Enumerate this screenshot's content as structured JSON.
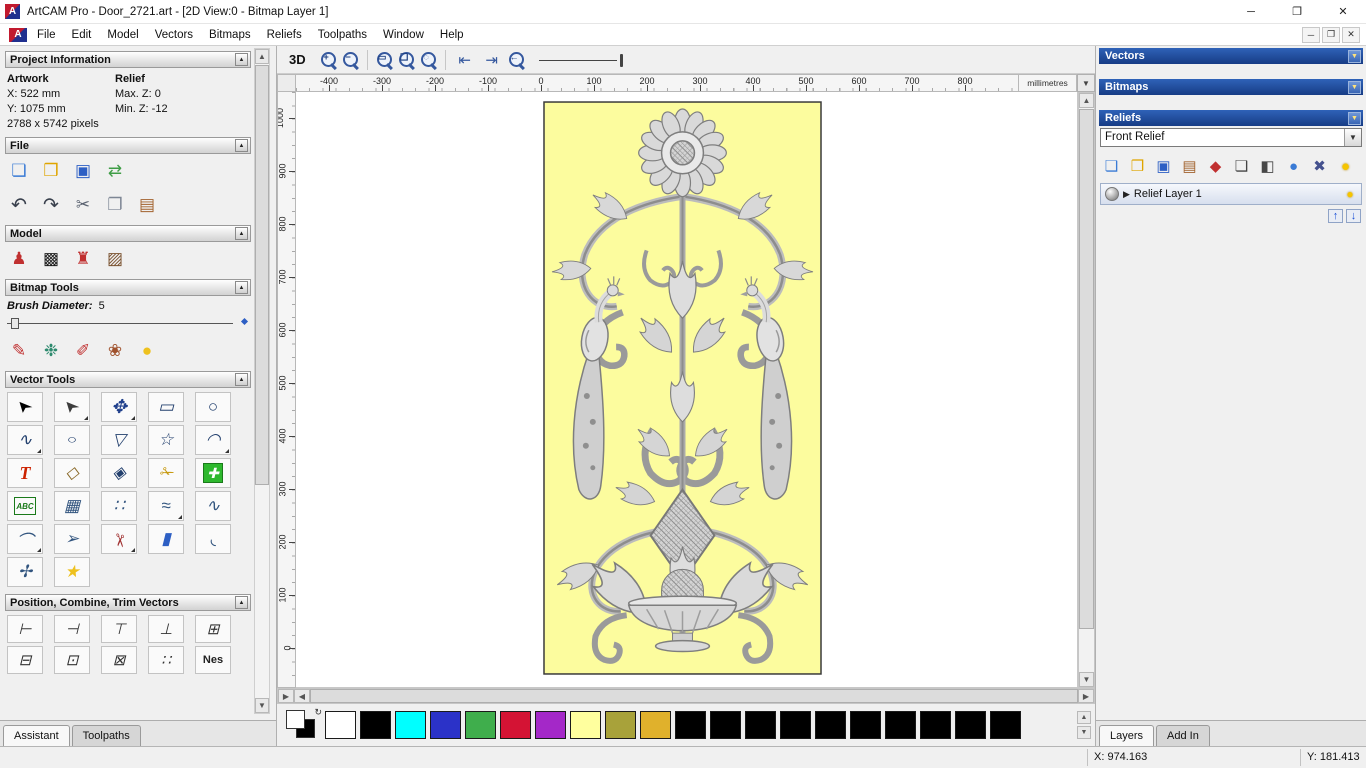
{
  "window": {
    "title": "ArtCAM Pro - Door_2721.art - [2D View:0 - Bitmap Layer 1]",
    "app_initial": "A"
  },
  "menu": {
    "items": [
      "File",
      "Edit",
      "Model",
      "Vectors",
      "Bitmaps",
      "Reliefs",
      "Toolpaths",
      "Window",
      "Help"
    ]
  },
  "assistant": {
    "tabs": {
      "assistant": "Assistant",
      "toolpaths": "Toolpaths"
    },
    "project_info": {
      "title": "Project Information",
      "artwork_label": "Artwork",
      "relief_label": "Relief",
      "x": "X: 522 mm",
      "y": "Y: 1075 mm",
      "pixels": "2788 x 5742 pixels",
      "max_z": "Max. Z: 0",
      "min_z": "Min. Z: -12"
    },
    "file_title": "File",
    "model_title": "Model",
    "bitmap_tools": {
      "title": "Bitmap Tools",
      "brush_label": "Brush Diameter:",
      "brush_value": "5"
    },
    "vector_tools_title": "Vector Tools",
    "position_title": "Position, Combine, Trim Vectors",
    "nesting_label": "Nes"
  },
  "view": {
    "toolbar": {
      "view_3d": "3D"
    },
    "ruler": {
      "horizontal": [
        "-400",
        "-300",
        "-200",
        "-100",
        "0",
        "100",
        "200",
        "300",
        "400",
        "500",
        "600",
        "700",
        "800"
      ],
      "vertical": [
        "1000",
        "900",
        "800",
        "700",
        "600",
        "500",
        "400",
        "300",
        "200",
        "100",
        "0"
      ],
      "units": "millimetres"
    }
  },
  "palette": {
    "swatches": [
      "#ffffff",
      "#000000",
      "#00ffff",
      "#2b32c8",
      "#3fae4c",
      "#d41334",
      "#a428c8",
      "#ffff9e",
      "#a8a23a",
      "#e0b12c",
      "#000000",
      "#000000",
      "#000000",
      "#000000",
      "#000000",
      "#000000",
      "#000000",
      "#000000",
      "#000000",
      "#000000"
    ]
  },
  "panels": {
    "vectors_title": "Vectors",
    "bitmaps_title": "Bitmaps",
    "reliefs_title": "Reliefs",
    "relief_selector": "Front Relief",
    "layer": {
      "name": "Relief Layer 1"
    },
    "tabs": {
      "layers": "Layers",
      "addin": "Add In"
    }
  },
  "status": {
    "x": "X: 974.163",
    "y": "Y: 181.413"
  },
  "icons": {
    "new-model": "❏",
    "open-model": "❒",
    "save-model": "▣",
    "export-model": "⇄",
    "undo": "↶",
    "redo": "↷",
    "cut": "✂",
    "copy": "❐",
    "paste": "▤",
    "set-model-size": "♟",
    "greyscale-preview": "▩",
    "lighthouse": "♜",
    "load-image": "▨",
    "paint-brush": "✎",
    "paint-selective": "❉",
    "airbrush": "✐",
    "colour-mix": "❀",
    "flood-fill": "●",
    "select": "➤",
    "node-edit": "➤",
    "transform": "✥",
    "rectangle": "▭",
    "circle": "○",
    "polyline": "∿",
    "ellipse": "○",
    "polygon": "▽",
    "star": "☆",
    "arc": "◠",
    "text": "T",
    "measure": "◇",
    "offset": "◈",
    "trim": "✁",
    "block-copy": "✚",
    "text-block": "ABC",
    "vector-grid": "▦",
    "paste-array": "∷",
    "fit-curve": "≈",
    "spline": "∿",
    "arc-fit": "⌒",
    "join": "➢",
    "slice": "✂",
    "extrude": "▮",
    "fillet": "◟",
    "distort": "✢",
    "wrap-star": "★",
    "align-left": "⊢",
    "align-right": "⊣",
    "align-top": "⊤",
    "align-bottom": "⊥",
    "align-centre": "⊞",
    "group": "⊟",
    "ungroup": "⊡",
    "weld": "⊠",
    "dots": "∷",
    "zoom-in": "+",
    "zoom-out": "−",
    "zoom-box": "▭",
    "zoom-page": "❑",
    "zoom-objects": "◌",
    "zoom-last": "←",
    "pan-left": "⇤",
    "pan-right": "⇥",
    "rp-new": "❏",
    "rp-open": "❒",
    "rp-save": "▣",
    "rp-merge": "▤",
    "rp-colour": "◆",
    "rp-sheet": "❏",
    "rp-contrast": "◧",
    "rp-sphere": "●",
    "rp-delete": "✖",
    "bulb": "●",
    "layer-up": "↑",
    "layer-down": "↓"
  }
}
